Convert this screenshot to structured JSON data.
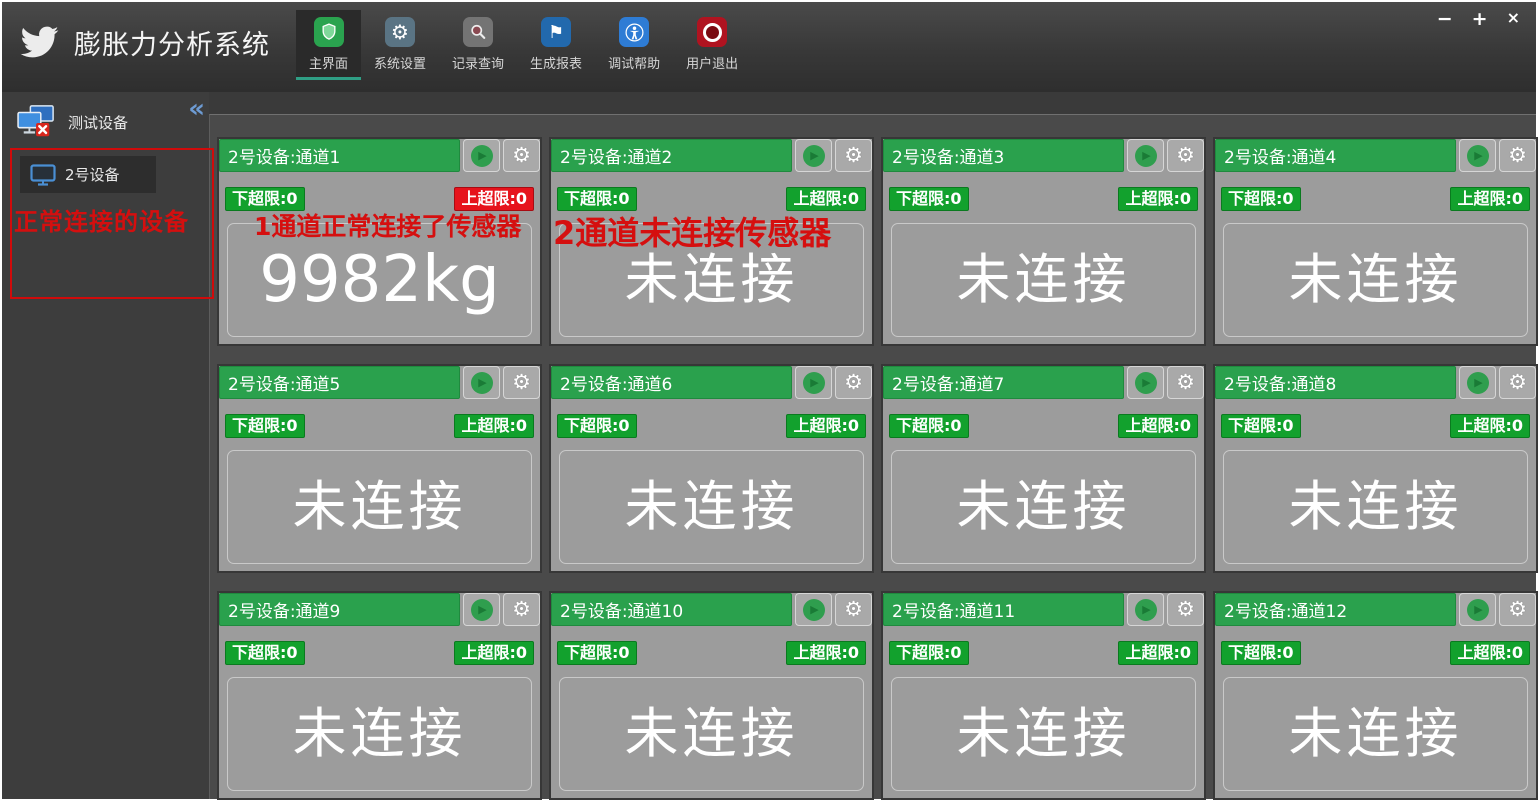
{
  "app": {
    "title": "膨胀力分析系统"
  },
  "window_controls": {
    "minimize": "−",
    "maximize": "+",
    "close": "×"
  },
  "toolbar": {
    "items": [
      {
        "label": "主界面",
        "icon": "shield-icon",
        "active": true
      },
      {
        "label": "系统设置",
        "icon": "gear-icon",
        "active": false
      },
      {
        "label": "记录查询",
        "icon": "search-icon",
        "active": false
      },
      {
        "label": "生成报表",
        "icon": "report-flag-icon",
        "active": false
      },
      {
        "label": "调试帮助",
        "icon": "debug-person-icon",
        "active": false
      },
      {
        "label": "用户退出",
        "icon": "exit-ring-icon",
        "active": false
      }
    ]
  },
  "icons": {
    "play": "▶",
    "gear": "⚙",
    "collapse": "«",
    "report_flag": "⚑"
  },
  "sidebar": {
    "collapse_icon": "«",
    "root_item": {
      "label": "测试设备"
    },
    "device_item": {
      "label": "2号设备"
    },
    "annotation": "正常连接的设备"
  },
  "main": {
    "annotations": {
      "channel1": "1通道正常连接了传感器",
      "channel2": "2通道未连接传感器"
    },
    "cards": [
      {
        "title": "2号设备:通道1",
        "lower": "下超限:0",
        "upper": "上超限:0",
        "value": "9982kg",
        "connected": true,
        "upper_alarm": true
      },
      {
        "title": "2号设备:通道2",
        "lower": "下超限:0",
        "upper": "上超限:0",
        "value": "未连接",
        "connected": false,
        "upper_alarm": false
      },
      {
        "title": "2号设备:通道3",
        "lower": "下超限:0",
        "upper": "上超限:0",
        "value": "未连接",
        "connected": false,
        "upper_alarm": false
      },
      {
        "title": "2号设备:通道4",
        "lower": "下超限:0",
        "upper": "上超限:0",
        "value": "未连接",
        "connected": false,
        "upper_alarm": false
      },
      {
        "title": "2号设备:通道5",
        "lower": "下超限:0",
        "upper": "上超限:0",
        "value": "未连接",
        "connected": false,
        "upper_alarm": false
      },
      {
        "title": "2号设备:通道6",
        "lower": "下超限:0",
        "upper": "上超限:0",
        "value": "未连接",
        "connected": false,
        "upper_alarm": false
      },
      {
        "title": "2号设备:通道7",
        "lower": "下超限:0",
        "upper": "上超限:0",
        "value": "未连接",
        "connected": false,
        "upper_alarm": false
      },
      {
        "title": "2号设备:通道8",
        "lower": "下超限:0",
        "upper": "上超限:0",
        "value": "未连接",
        "connected": false,
        "upper_alarm": false
      },
      {
        "title": "2号设备:通道9",
        "lower": "下超限:0",
        "upper": "上超限:0",
        "value": "未连接",
        "connected": false,
        "upper_alarm": false
      },
      {
        "title": "2号设备:通道10",
        "lower": "下超限:0",
        "upper": "上超限:0",
        "value": "未连接",
        "connected": false,
        "upper_alarm": false
      },
      {
        "title": "2号设备:通道11",
        "lower": "下超限:0",
        "upper": "上超限:0",
        "value": "未连接",
        "connected": false,
        "upper_alarm": false
      },
      {
        "title": "2号设备:通道12",
        "lower": "下超限:0",
        "upper": "上超限:0",
        "value": "未连接",
        "connected": false,
        "upper_alarm": false
      }
    ]
  },
  "colors": {
    "header_green": "#2aa14d",
    "badge_green": "#12a12d",
    "badge_red": "#e6131c",
    "annotation_red": "#d50f0f",
    "active_tab_underline": "#2f9f85",
    "card_gray": "#9c9c9c",
    "panel_dark": "#4a4a4a"
  }
}
